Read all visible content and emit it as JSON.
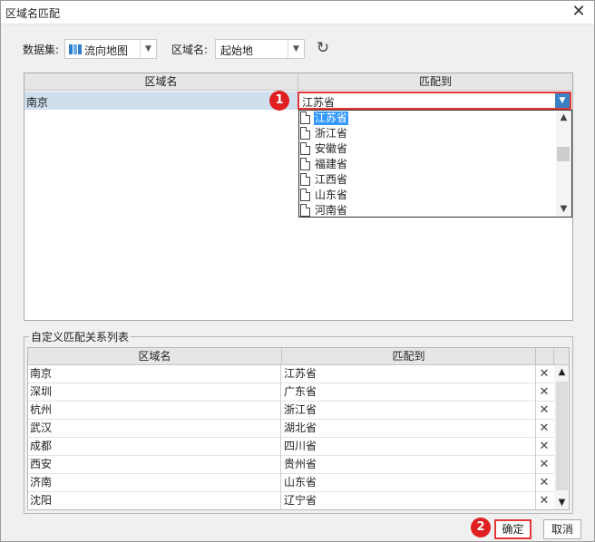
{
  "window": {
    "title": "区域名匹配",
    "close_glyph": "✕"
  },
  "toolbar": {
    "dataset_label": "数据集:",
    "dataset_value": "流向地图",
    "region_label": "区域名:",
    "region_value": "起始地",
    "refresh_glyph": "↻"
  },
  "grid": {
    "col1": "区域名",
    "col2": "匹配到",
    "selected_region": "南京",
    "selected_match": "江苏省"
  },
  "dropdown": {
    "items": [
      "江苏省",
      "浙江省",
      "安徽省",
      "福建省",
      "江西省",
      "山东省",
      "河南省"
    ],
    "selected_index": 0
  },
  "badges": {
    "one": "1",
    "two": "2"
  },
  "custom_list": {
    "title": "自定义匹配关系列表",
    "col1": "区域名",
    "col2": "匹配到",
    "rows": [
      {
        "region": "南京",
        "match": "江苏省"
      },
      {
        "region": "深圳",
        "match": "广东省"
      },
      {
        "region": "杭州",
        "match": "浙江省"
      },
      {
        "region": "武汉",
        "match": "湖北省"
      },
      {
        "region": "成都",
        "match": "四川省"
      },
      {
        "region": "西安",
        "match": "贵州省"
      },
      {
        "region": "济南",
        "match": "山东省"
      },
      {
        "region": "沈阳",
        "match": "辽宁省"
      }
    ],
    "delete_glyph": "✕"
  },
  "footer": {
    "ok_label": "确定",
    "cancel_label": "取消"
  },
  "colors": {
    "highlight": "#e63737",
    "selection": "#3399ff",
    "badge": "#e02020"
  }
}
